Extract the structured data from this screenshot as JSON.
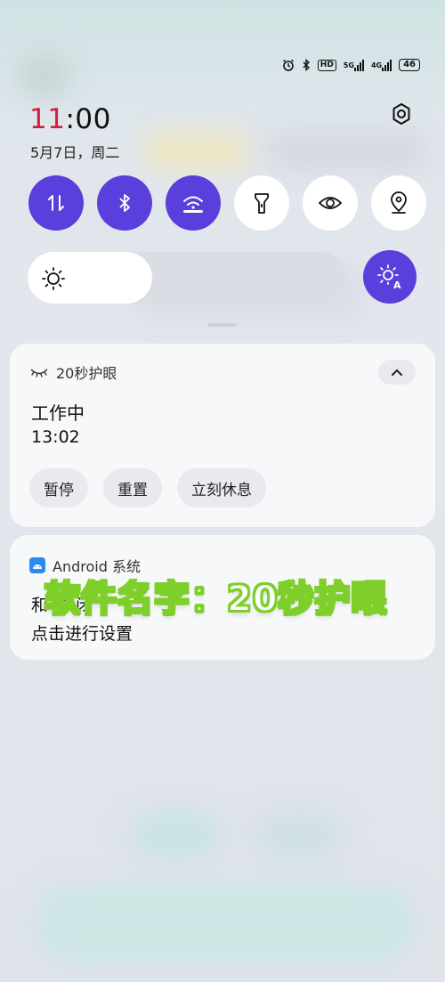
{
  "status_bar": {
    "network1": "5G",
    "network2": "4G",
    "hd": "HD",
    "battery": "46"
  },
  "clock": {
    "hour": "11",
    "rest": ":00"
  },
  "date": "5月7日，周二",
  "quick_tiles": [
    {
      "name": "mobile-data",
      "icon": "arrows-updown-icon",
      "active": true
    },
    {
      "name": "bluetooth",
      "icon": "bluetooth-icon",
      "active": true
    },
    {
      "name": "wifi",
      "icon": "wifi-icon",
      "active": true
    },
    {
      "name": "flashlight",
      "icon": "flashlight-icon",
      "active": false
    },
    {
      "name": "eye-comfort",
      "icon": "eye-icon",
      "active": false
    },
    {
      "name": "location",
      "icon": "location-pin-icon",
      "active": false
    }
  ],
  "brightness": {
    "level": 0.39,
    "auto_label": "A"
  },
  "notifications": [
    {
      "app": "20秒护眼",
      "title": "工作中",
      "time": "13:02",
      "actions": [
        "暂停",
        "重置",
        "立刻休息"
      ]
    },
    {
      "app": "Android 系统",
      "line1": "和      中      闭",
      "line2": "点击进行设置"
    }
  ],
  "overlay_caption": "软件名字：20秒护眼",
  "colors": {
    "accent": "#5b3fdc",
    "clock_red": "#d0203a",
    "caption_stroke": "#7ecf2a"
  }
}
